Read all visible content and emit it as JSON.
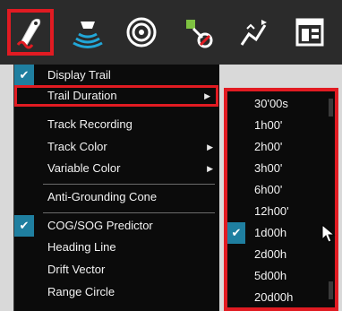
{
  "colors": {
    "accent": "#1f7fa0",
    "highlight_border": "#e11b22",
    "toolbar_bg": "#2b2b2b",
    "menu_bg": "#0b0b0b"
  },
  "toolbar": {
    "buttons": [
      {
        "icon": "boat-trail-icon",
        "active": true
      },
      {
        "icon": "sonar-icon",
        "active": false
      },
      {
        "icon": "radar-icon",
        "active": false
      },
      {
        "icon": "route-waypoint-icon",
        "active": false
      },
      {
        "icon": "route-plan-icon",
        "active": false
      },
      {
        "icon": "panel-settings-icon",
        "active": false
      }
    ]
  },
  "menu": {
    "items": [
      {
        "label": "Display Trail",
        "checked": true,
        "submenu": false
      },
      {
        "label": "Trail Duration",
        "checked": false,
        "submenu": true
      },
      {
        "label": "Track Recording",
        "checked": false,
        "submenu": false
      },
      {
        "label": "Track Color",
        "checked": false,
        "submenu": true
      },
      {
        "label": "Variable Color",
        "checked": false,
        "submenu": true
      },
      {
        "label": "Anti-Grounding Cone",
        "checked": false,
        "submenu": false
      },
      {
        "label": "COG/SOG Predictor",
        "checked": true,
        "submenu": false
      },
      {
        "label": "Heading Line",
        "checked": false,
        "submenu": false
      },
      {
        "label": "Drift Vector",
        "checked": false,
        "submenu": false
      },
      {
        "label": "Range Circle",
        "checked": false,
        "submenu": false
      }
    ],
    "arrow_glyph": "▶",
    "check_glyph": "✔"
  },
  "trail_duration": {
    "options": [
      "30'00s",
      "1h00'",
      "2h00'",
      "3h00'",
      "6h00'",
      "12h00'",
      "1d00h",
      "2d00h",
      "5d00h",
      "20d00h"
    ],
    "selected": "1d00h"
  }
}
